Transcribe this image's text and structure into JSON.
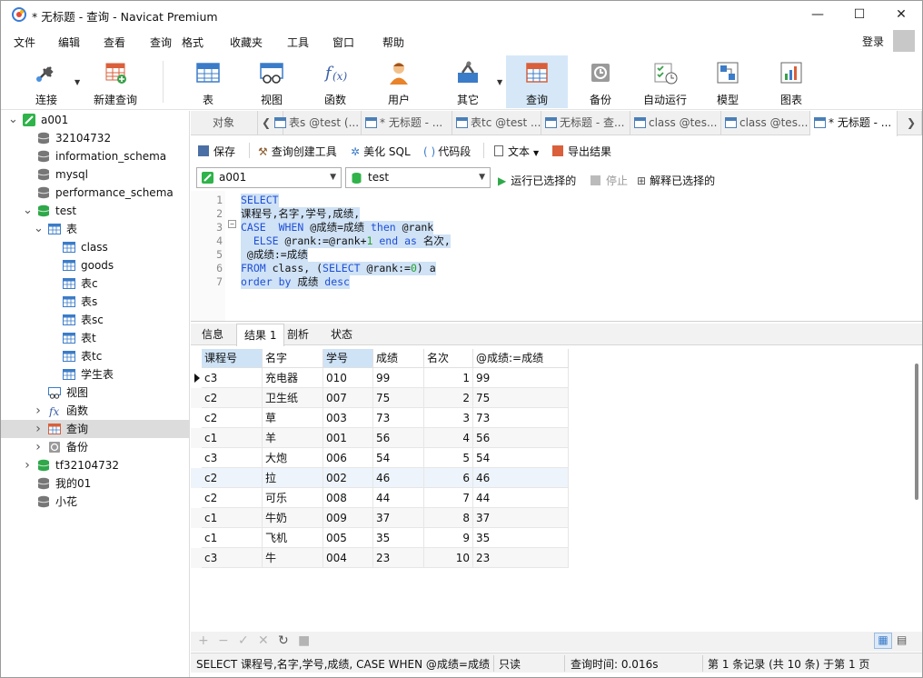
{
  "window": {
    "title": "* 无标题 - 查询 - Navicat Premium"
  },
  "menu": [
    "文件",
    "编辑",
    "查看",
    "查询",
    "格式",
    "收藏夹",
    "工具",
    "窗口",
    "帮助"
  ],
  "login_label": "登录",
  "toolbar": [
    {
      "label": "连接",
      "icon": "plug-icon"
    },
    {
      "label": "新建查询",
      "icon": "new-query-icon"
    },
    {
      "label": "表",
      "icon": "table-icon"
    },
    {
      "label": "视图",
      "icon": "view-icon"
    },
    {
      "label": "函数",
      "icon": "function-icon"
    },
    {
      "label": "用户",
      "icon": "user-icon"
    },
    {
      "label": "其它",
      "icon": "tools-icon"
    },
    {
      "label": "查询",
      "icon": "query-icon"
    },
    {
      "label": "备份",
      "icon": "backup-icon"
    },
    {
      "label": "自动运行",
      "icon": "schedule-icon"
    },
    {
      "label": "模型",
      "icon": "model-icon"
    },
    {
      "label": "图表",
      "icon": "chart-icon"
    }
  ],
  "tree": [
    {
      "label": "a001",
      "level": 0,
      "icon": "connection-icon",
      "expanded": true
    },
    {
      "label": "32104732",
      "level": 1,
      "icon": "database-icon"
    },
    {
      "label": "information_schema",
      "level": 1,
      "icon": "database-icon"
    },
    {
      "label": "mysql",
      "level": 1,
      "icon": "database-icon"
    },
    {
      "label": "performance_schema",
      "level": 1,
      "icon": "database-icon"
    },
    {
      "label": "test",
      "level": 1,
      "icon": "database-open-icon",
      "expanded": true
    },
    {
      "label": "表",
      "level": 2,
      "icon": "table-folder-icon",
      "expanded": true
    },
    {
      "label": "class",
      "level": 3,
      "icon": "table-icon"
    },
    {
      "label": "goods",
      "level": 3,
      "icon": "table-icon"
    },
    {
      "label": "表c",
      "level": 3,
      "icon": "table-icon"
    },
    {
      "label": "表s",
      "level": 3,
      "icon": "table-icon"
    },
    {
      "label": "表sc",
      "level": 3,
      "icon": "table-icon"
    },
    {
      "label": "表t",
      "level": 3,
      "icon": "table-icon"
    },
    {
      "label": "表tc",
      "level": 3,
      "icon": "table-icon"
    },
    {
      "label": "学生表",
      "level": 3,
      "icon": "table-icon"
    },
    {
      "label": "视图",
      "level": 2,
      "icon": "view-icon"
    },
    {
      "label": "函数",
      "level": 2,
      "icon": "function-icon",
      "collapsed": true
    },
    {
      "label": "查询",
      "level": 2,
      "icon": "query-icon",
      "collapsed": true,
      "selected": true
    },
    {
      "label": "备份",
      "level": 2,
      "icon": "backup-icon",
      "collapsed": true
    },
    {
      "label": "tf32104732",
      "level": 1,
      "icon": "database-open-icon",
      "collapsed": true
    },
    {
      "label": "我的01",
      "level": 1,
      "icon": "database-icon"
    },
    {
      "label": "小花",
      "level": 1,
      "icon": "database-icon"
    }
  ],
  "tabs": [
    "对象",
    "表s @test (...",
    "* 无标题 - ...",
    "表tc @test ...",
    "无标题 - 查...",
    "class @tes...",
    "class @tes...",
    "* 无标题 - ..."
  ],
  "query_toolbar": {
    "save": "保存",
    "builder": "查询创建工具",
    "beautify": "美化 SQL",
    "snippet": "代码段",
    "text": "文本",
    "export": "导出结果"
  },
  "connection": {
    "conn": "a001",
    "db": "test",
    "run_selected": "运行已选择的",
    "stop": "停止",
    "explain": "解释已选择的"
  },
  "sql_lines": [
    "SELECT",
    "课程号,名字,学号,成绩,",
    "CASE  WHEN @成绩=成绩 then @rank",
    "  ELSE @rank:=@rank+1 end as 名次,",
    " @成绩:=成绩",
    "FROM class, (SELECT @rank:=0) a",
    "order by 成绩 desc"
  ],
  "result_tabs": [
    "信息",
    "结果 1",
    "剖析",
    "状态"
  ],
  "columns": [
    "课程号",
    "名字",
    "学号",
    "成绩",
    "名次",
    "@成绩:=成绩"
  ],
  "rows": [
    [
      "c3",
      "充电器",
      "010",
      "99",
      "1",
      "99"
    ],
    [
      "c2",
      "卫生纸",
      "007",
      "75",
      "2",
      "75"
    ],
    [
      "c2",
      "草",
      "003",
      "73",
      "3",
      "73"
    ],
    [
      "c1",
      "羊",
      "001",
      "56",
      "4",
      "56"
    ],
    [
      "c3",
      "大炮",
      "006",
      "54",
      "5",
      "54"
    ],
    [
      "c2",
      "拉",
      "002",
      "46",
      "6",
      "46"
    ],
    [
      "c2",
      "可乐",
      "008",
      "44",
      "7",
      "44"
    ],
    [
      "c1",
      "牛奶",
      "009",
      "37",
      "8",
      "37"
    ],
    [
      "c1",
      "飞机",
      "005",
      "35",
      "9",
      "35"
    ],
    [
      "c3",
      "牛",
      "004",
      "23",
      "10",
      "23"
    ]
  ],
  "status": {
    "sql": "SELECT 课程号,名字,学号,成绩, CASE  WHEN @成绩=成绩 ·",
    "mode": "只读",
    "time": "查询时间: 0.016s",
    "records": "第 1 条记录 (共 10 条) 于第 1 页"
  }
}
